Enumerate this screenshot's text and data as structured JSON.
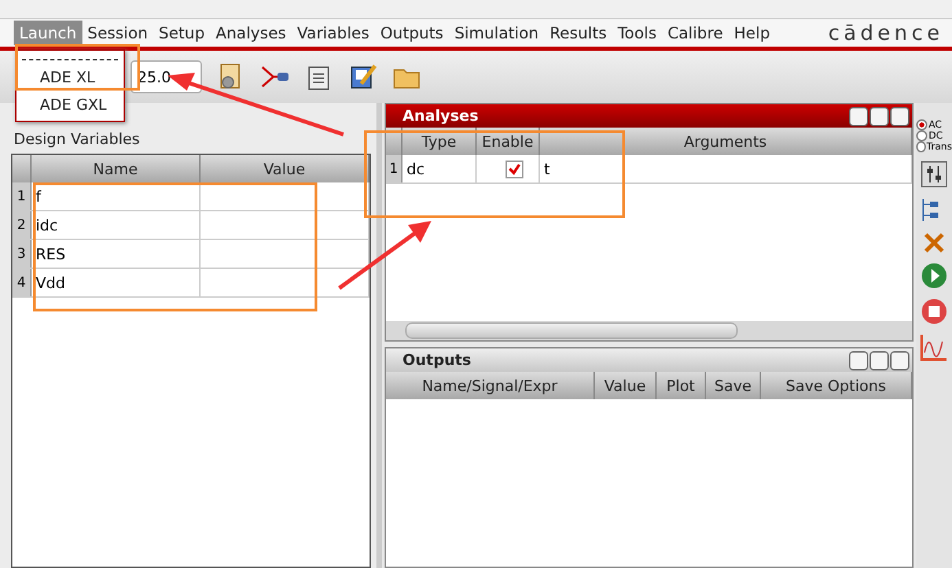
{
  "menubar": {
    "items": [
      {
        "label": "Launch",
        "selected": true
      },
      {
        "label": "Session",
        "selected": false
      },
      {
        "label": "Setup",
        "selected": false
      },
      {
        "label": "Analyses",
        "selected": false
      },
      {
        "label": "Variables",
        "selected": false
      },
      {
        "label": "Outputs",
        "selected": false
      },
      {
        "label": "Simulation",
        "selected": false
      },
      {
        "label": "Results",
        "selected": false
      },
      {
        "label": "Tools",
        "selected": false
      },
      {
        "label": "Calibre",
        "selected": false
      },
      {
        "label": "Help",
        "selected": false
      }
    ],
    "logo": "cādence"
  },
  "launch_menu": {
    "items": [
      "ADE XL",
      "ADE GXL"
    ]
  },
  "toolbar": {
    "temperature": "25.0"
  },
  "design_variables": {
    "title": "Design Variables",
    "columns": [
      "Name",
      "Value"
    ],
    "rows": [
      {
        "index": "1",
        "name": "f",
        "value": ""
      },
      {
        "index": "2",
        "name": "idc",
        "value": ""
      },
      {
        "index": "3",
        "name": "RES",
        "value": ""
      },
      {
        "index": "4",
        "name": "Vdd",
        "value": ""
      }
    ]
  },
  "analyses": {
    "title": "Analyses",
    "columns": [
      "Type",
      "Enable",
      "Arguments"
    ],
    "rows": [
      {
        "index": "1",
        "type": "dc",
        "enabled": true,
        "arguments": "t"
      }
    ]
  },
  "outputs": {
    "title": "Outputs",
    "columns": [
      "Name/Signal/Expr",
      "Value",
      "Plot",
      "Save",
      "Save Options"
    ]
  },
  "side": {
    "radios": [
      {
        "label": "AC",
        "selected": true
      },
      {
        "label": "DC",
        "selected": false
      },
      {
        "label": "Trans",
        "selected": false
      }
    ]
  }
}
